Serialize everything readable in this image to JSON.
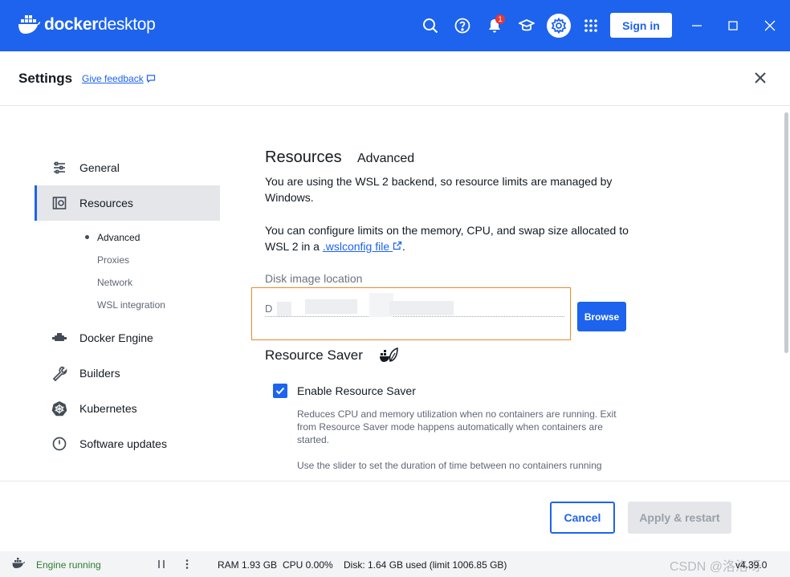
{
  "titlebar": {
    "logo_word1": "docker",
    "logo_word2": "desktop",
    "notification_count": "1",
    "sign_in_label": "Sign in"
  },
  "header": {
    "title": "Settings",
    "feedback_label": "Give feedback"
  },
  "sidebar": {
    "items": [
      {
        "label": "General",
        "icon": "sliders-icon"
      },
      {
        "label": "Resources",
        "icon": "resources-icon"
      },
      {
        "label": "Docker Engine",
        "icon": "engine-icon"
      },
      {
        "label": "Builders",
        "icon": "wrench-icon"
      },
      {
        "label": "Kubernetes",
        "icon": "kubernetes-icon"
      },
      {
        "label": "Software updates",
        "icon": "clock-icon"
      }
    ],
    "sub_items": [
      "Advanced",
      "Proxies",
      "Network",
      "WSL integration"
    ]
  },
  "content": {
    "title": "Resources",
    "subtitle": "Advanced",
    "para1": "You are using the WSL 2 backend, so resource limits are managed by Windows.",
    "para2_prefix": "You can configure limits on the memory, CPU, and swap size allocated to WSL 2 in a ",
    "para2_link": ".wslconfig file",
    "para2_suffix": ".",
    "disk_label": "Disk image location",
    "disk_value": "D",
    "browse_label": "Browse",
    "saver_title": "Resource Saver",
    "enable_label": "Enable Resource Saver",
    "desc1": "Reduces CPU and memory utilization when no containers are running. Exit from Resource Saver mode happens automatically when containers are started.",
    "desc2": "Use the slider to set the duration of time between no containers running"
  },
  "footer": {
    "cancel_label": "Cancel",
    "apply_label": "Apply & restart"
  },
  "statusbar": {
    "engine_status": "Engine running",
    "ram": "RAM 1.93 GB",
    "cpu": "CPU 0.00%",
    "disk": "Disk: 1.64 GB used (limit 1006.85 GB)",
    "watermark": "CSDN @洛洛呀",
    "version": "v4.39.0"
  },
  "colors": {
    "brand": "#1d63ed",
    "focus_border": "#e88a2e",
    "engine_ok": "#2e7d32"
  }
}
